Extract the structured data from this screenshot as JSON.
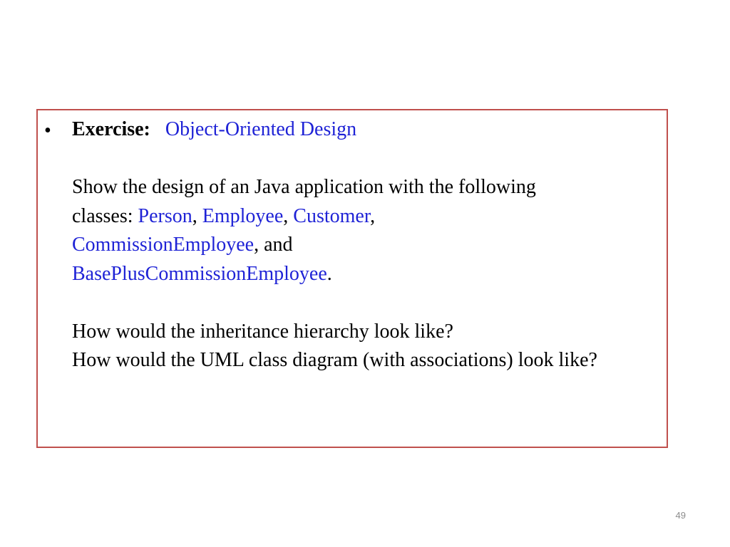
{
  "exercise": {
    "bullet": "•",
    "label": "Exercise:",
    "title": "Object-Oriented Design"
  },
  "prompt": {
    "intro": "Show the design of an Java application with the following",
    "classes_prefix": "classes: ",
    "sep": ", ",
    "and_sep": ", and",
    "period": ".",
    "classes": [
      "Person",
      "Employee",
      "Customer",
      "CommissionEmployee",
      "BasePlusCommissionEmployee"
    ]
  },
  "questions": {
    "q1": "How would the inheritance hierarchy look like?",
    "q2": "How would the UML class diagram (with associations) look like?"
  },
  "slide": {
    "number": "49"
  },
  "colors": {
    "border": "#c0504d",
    "accent_text": "#1f23d6",
    "slide_number": "#8c8c8c"
  }
}
